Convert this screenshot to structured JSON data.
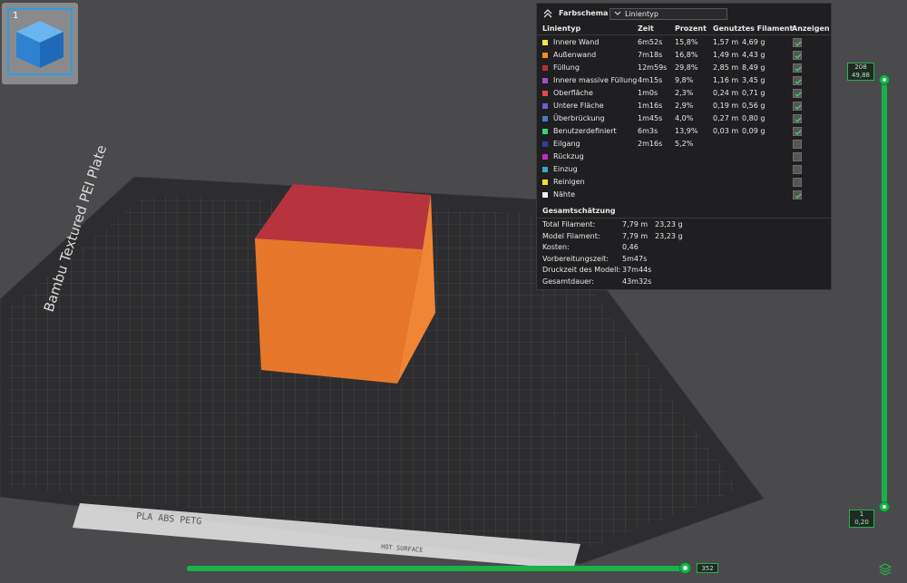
{
  "plate": {
    "name": "Bambu Textured PEI Plate",
    "badge_text": "PLA ABS PETG",
    "tag_text": "HOT SURFACE"
  },
  "object_list": {
    "index": "1"
  },
  "legend": {
    "scheme_label": "Farbschema",
    "scheme_value": "Linientyp",
    "headers": {
      "type": "Linientyp",
      "time": "Zeit",
      "percent": "Prozent",
      "filament": "Genutztes Filament",
      "show": "Anzeigen"
    },
    "rows": [
      {
        "name": "Innere Wand",
        "color": "#f5e63c",
        "time": "6m52s",
        "percent": "15,8%",
        "length": "1,57 m",
        "weight": "4,69 g",
        "shown": true
      },
      {
        "name": "Außenwand",
        "color": "#ff8a1f",
        "time": "7m18s",
        "percent": "16,8%",
        "length": "1,49 m",
        "weight": "4,43 g",
        "shown": true
      },
      {
        "name": "Füllung",
        "color": "#b53030",
        "time": "12m59s",
        "percent": "29,8%",
        "length": "2,85 m",
        "weight": "8,49 g",
        "shown": true
      },
      {
        "name": "Innere massive Füllung",
        "color": "#a050c8",
        "time": "4m15s",
        "percent": "9,8%",
        "length": "1,16 m",
        "weight": "3,45 g",
        "shown": true
      },
      {
        "name": "Oberfläche",
        "color": "#e84848",
        "time": "1m0s",
        "percent": "2,3%",
        "length": "0,24 m",
        "weight": "0,71 g",
        "shown": true
      },
      {
        "name": "Untere Fläche",
        "color": "#6a60d0",
        "time": "1m16s",
        "percent": "2,9%",
        "length": "0,19 m",
        "weight": "0,56 g",
        "shown": true
      },
      {
        "name": "Überbrückung",
        "color": "#4a7ac0",
        "time": "1m45s",
        "percent": "4,0%",
        "length": "0,27 m",
        "weight": "0,80 g",
        "shown": true
      },
      {
        "name": "Benutzerdefiniert",
        "color": "#3ccf74",
        "time": "6m3s",
        "percent": "13,9%",
        "length": "0,03 m",
        "weight": "0,09 g",
        "shown": true
      },
      {
        "name": "Eilgang",
        "color": "#3a3aa0",
        "time": "2m16s",
        "percent": "5,2%",
        "length": "",
        "weight": "",
        "shown": false
      },
      {
        "name": "Rückzug",
        "color": "#c030c0",
        "time": "",
        "percent": "",
        "length": "",
        "weight": "",
        "shown": false
      },
      {
        "name": "Einzug",
        "color": "#3aa6c8",
        "time": "",
        "percent": "",
        "length": "",
        "weight": "",
        "shown": false
      },
      {
        "name": "Reinigen",
        "color": "#f5e020",
        "time": "",
        "percent": "",
        "length": "",
        "weight": "",
        "shown": false
      },
      {
        "name": "Nähte",
        "color": "#f0f0f0",
        "time": "",
        "percent": "",
        "length": "",
        "weight": "",
        "shown": true
      }
    ],
    "estimate_title": "Gesamtschätzung",
    "estimate": [
      {
        "label": "Total Filament:",
        "value": "7,79 m",
        "value2": "23,23 g"
      },
      {
        "label": "Model Filament:",
        "value": "7,79 m",
        "value2": "23,23 g"
      },
      {
        "label": "Kosten:",
        "value": "0,46",
        "value2": ""
      },
      {
        "label": "Vorbereitungszeit:",
        "value": "5m47s",
        "value2": ""
      },
      {
        "label": "Druckzeit des Modell:",
        "value": "37m44s",
        "value2": ""
      },
      {
        "label": "Gesamtdauer:",
        "value": "43m32s",
        "value2": ""
      }
    ]
  },
  "layer_slider": {
    "top_layer": "208",
    "top_height": "49,88",
    "bottom_layer": "1",
    "bottom_height": "0,20"
  },
  "move_slider": {
    "value": "352"
  },
  "colors": {
    "accent": "#19b24a",
    "cube_top": "#b7343e",
    "cube_side": "#ea7a2c"
  }
}
